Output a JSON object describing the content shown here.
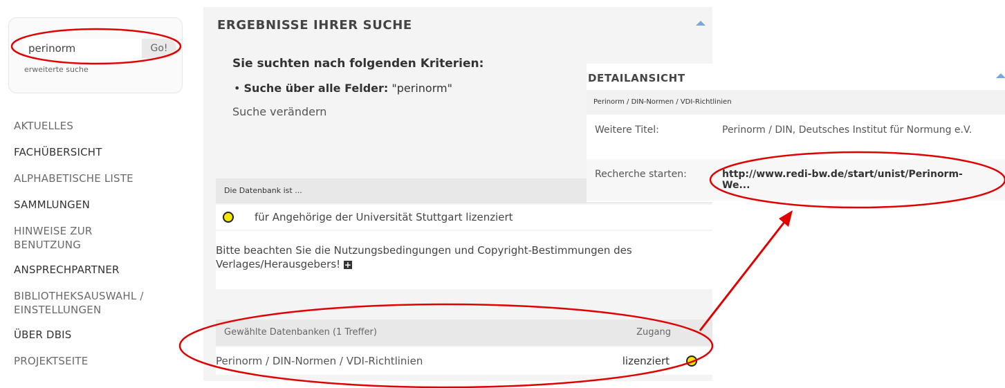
{
  "search": {
    "value": "perinorm",
    "go_label": "Go!",
    "advanced_label": "erweiterte suche"
  },
  "nav": {
    "items": [
      {
        "label": "AKTUELLES"
      },
      {
        "label": "FACHÜBERSICHT"
      },
      {
        "label": "ALPHABETISCHE LISTE"
      },
      {
        "label": "SAMMLUNGEN"
      },
      {
        "label": "HINWEISE ZUR BENUTZUNG"
      },
      {
        "label": "ANSPRECHPARTNER"
      },
      {
        "label": "BIBLIOTHEKSAUSWAHL / EINSTELLUNGEN"
      },
      {
        "label": "ÜBER DBIS"
      },
      {
        "label": "PROJEKTSEITE"
      }
    ]
  },
  "results": {
    "title": "ERGEBNISSE IHRER SUCHE",
    "criteria_heading": "Sie suchten nach folgenden Kriterien:",
    "criteria_label": "Suche über alle Felder:",
    "criteria_value": "\"perinorm\"",
    "change_search": "Suche verändern",
    "db_heading": "Die Datenbank ist ...",
    "license_text": "für Angehörige der Universität Stuttgart lizenziert",
    "license_color": "#f5e600",
    "note": "Bitte beachten Sie die Nutzungsbedingungen und Copyright-Bestimmungen des Verlages/Herausgebers!",
    "selected_heading": "Gewählte Datenbanken (1 Treffer)",
    "access_heading": "Zugang",
    "db_name": "Perinorm / DIN-Normen / VDI-Richtlinien",
    "db_access": "lizenziert"
  },
  "detail": {
    "title": "DETAILANSICHT",
    "subtitle": "Perinorm / DIN-Normen / VDI-Richtlinien",
    "more_titles_label": "Weitere Titel:",
    "more_titles_value": "Perinorm / DIN, Deutsches Institut für Normung e.V.",
    "start_label": "Recherche starten:",
    "start_link": "http://www.redi-bw.de/start/unist/Perinorm-We..."
  },
  "annotation_color": "#e00000"
}
